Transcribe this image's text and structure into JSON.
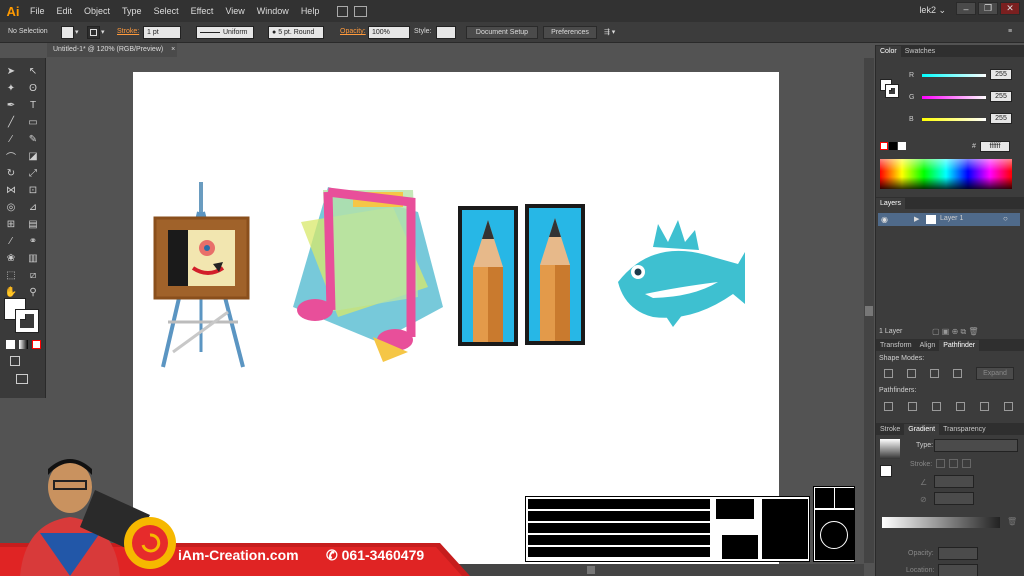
{
  "app": {
    "logo": "Ai"
  },
  "menu": [
    "File",
    "Edit",
    "Object",
    "Type",
    "Select",
    "Effect",
    "View",
    "Window",
    "Help"
  ],
  "workspace": "lek2",
  "window_controls": [
    "–",
    "❐",
    "✕"
  ],
  "control_bar": {
    "selection": "No Selection",
    "stroke_label": "Stroke:",
    "stroke_weight": "1 pt",
    "profile": "Uniform",
    "brush": "5 pt. Round",
    "opacity_label": "Opacity:",
    "opacity_value": "100%",
    "style_label": "Style:",
    "doc_setup": "Document Setup",
    "preferences": "Preferences"
  },
  "document_tab": "Untitled-1* @ 120% (RGB/Preview)",
  "color_panel": {
    "tabs": [
      "Color",
      "Swatches"
    ],
    "channels": [
      {
        "label": "R",
        "value": "255",
        "color": "#00e5ff"
      },
      {
        "label": "G",
        "value": "255",
        "color": "#ff00ff"
      },
      {
        "label": "B",
        "value": "255",
        "color": "#ffff00"
      }
    ],
    "hex_label": "#",
    "hex_value": "ffffff"
  },
  "layers_panel": {
    "tab": "Layers",
    "layer_name": "Layer 1",
    "count": "1 Layer"
  },
  "pathfinder_panel": {
    "tabs": [
      "Transform",
      "Align",
      "Pathfinder"
    ],
    "shape_modes": "Shape Modes:",
    "expand": "Expand",
    "pathfinders": "Pathfinders:"
  },
  "gradient_panel": {
    "tabs": [
      "Stroke",
      "Gradient",
      "Transparency"
    ],
    "type_label": "Type:",
    "stroke_label": "Stroke:",
    "opacity_label": "Opacity:",
    "location_label": "Location:"
  },
  "promo": {
    "brand": "iAm-Creation.com",
    "phone": "061-3460479"
  }
}
